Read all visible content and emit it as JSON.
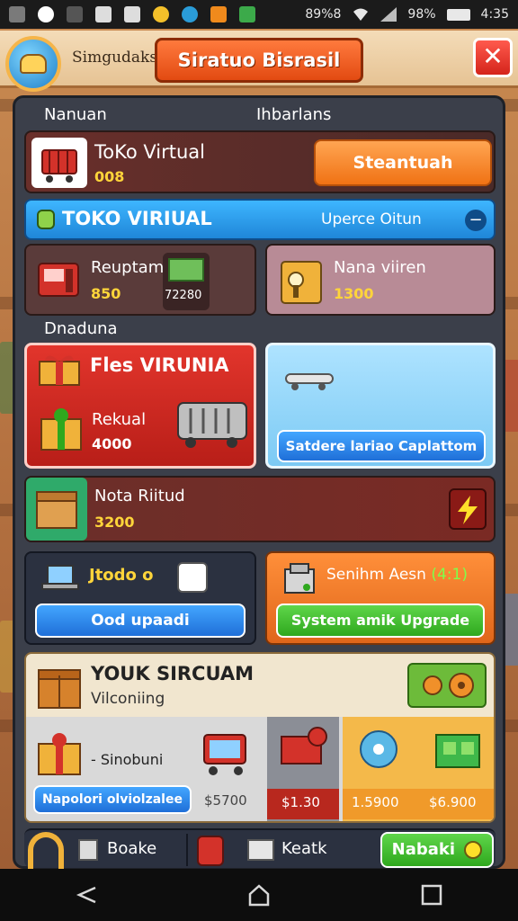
{
  "status_bar": {
    "battery": "98%",
    "time": "4:35",
    "signal_text": "89%8"
  },
  "header": {
    "app_name": "Simgudaks",
    "title": "Siratuo Bisrasil",
    "close_label": "✕"
  },
  "sections": {
    "top_left_label": "Nanuan",
    "top_right_label": "Ihbarlans",
    "second_label": "Dnaduna"
  },
  "store_row": {
    "name": "ToKo Virtual",
    "value": "008",
    "button": "Steantuah"
  },
  "blue_banner": {
    "title": "TOKO VIRIUAL",
    "right_label": "Uperce Oitun"
  },
  "item_a": {
    "name": "Reuptam,",
    "value": "850",
    "badge": "72280"
  },
  "item_b": {
    "name": "Nana viiren",
    "value": "1300"
  },
  "red_card": {
    "title": "Fles VIRUNIA",
    "item_name": "Rekual",
    "item_value": "4000"
  },
  "blue_card": {
    "button": "Satdere lariao Caplattom"
  },
  "nota_row": {
    "name": "Nota Riitud",
    "value": "3200"
  },
  "bottom_left_card": {
    "label": "Jtodo o",
    "button": "Ood upaadi"
  },
  "bottom_right_card": {
    "label": "Senihm Aesn",
    "label_extra": "(4:1)",
    "button": "System amik Upgrade"
  },
  "your_store": {
    "title": "YOUK SIRCUAM",
    "subtitle": "Vilconiing",
    "item_label": "- Sinobuni",
    "button": "Napolori olviolzalee",
    "prices": [
      "$5700",
      "$1.30",
      "1.5900",
      "$6.900"
    ]
  },
  "tab_bar": {
    "tab1": "Boake",
    "tab2": "Keatk",
    "tab3": "Nabaki"
  },
  "colors": {
    "accent_orange": "#f07214",
    "accent_blue": "#1f8bd8",
    "accent_green": "#2fa81e",
    "accent_red": "#d4241b",
    "panel_dark": "#3b3f4a"
  },
  "icons": [
    "store-logo-icon",
    "close-icon",
    "cart-icon",
    "cash-register-icon",
    "money-icon",
    "safe-icon",
    "gift-icon",
    "bus-icon",
    "skateboard-icon",
    "box-icon",
    "lightning-icon",
    "laptop-icon",
    "notebook-icon",
    "cash-machine-icon",
    "gear-icon",
    "camera-icon",
    "disc-icon",
    "device-icon",
    "search-icon",
    "back-icon",
    "home-icon",
    "recents-icon"
  ]
}
